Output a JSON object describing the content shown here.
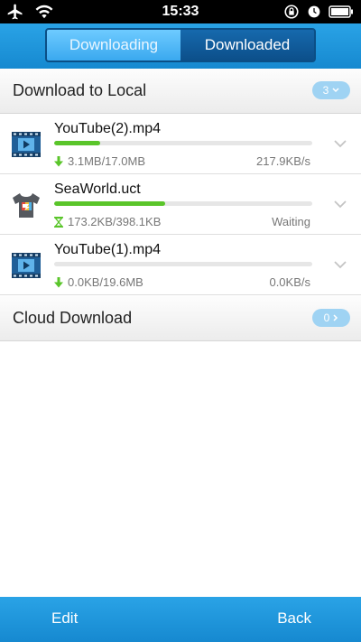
{
  "status_bar": {
    "time": "15:33",
    "left_icons": [
      "airplane-icon",
      "wifi-icon"
    ],
    "right_icons": [
      "rotation-lock-icon",
      "alarm-icon",
      "battery-icon"
    ]
  },
  "header": {
    "tabs": [
      {
        "label": "Downloading",
        "active": true
      },
      {
        "label": "Downloaded",
        "active": false
      }
    ]
  },
  "local_section": {
    "title": "Download to Local",
    "count": "3"
  },
  "downloads": [
    {
      "name": "YouTube(2).mp4",
      "icon": "video-file-icon",
      "status_icon": "download-arrow-icon",
      "progress": 0.18,
      "size": "3.1MB/17.0MB",
      "state": "217.9KB/s"
    },
    {
      "name": "SeaWorld.uct",
      "icon": "theme-shirt-icon",
      "status_icon": "hourglass-icon",
      "progress": 0.43,
      "size": "173.2KB/398.1KB",
      "state": "Waiting"
    },
    {
      "name": "YouTube(1).mp4",
      "icon": "video-file-icon",
      "status_icon": "download-arrow-icon",
      "progress": 0.0,
      "size": "0.0KB/19.6MB",
      "state": "0.0KB/s"
    }
  ],
  "cloud_section": {
    "title": "Cloud Download",
    "count": "0"
  },
  "bottom_bar": {
    "edit_label": "Edit",
    "back_label": "Back"
  },
  "colors": {
    "accent": "#1e95dc",
    "progress": "#5ac52a",
    "badge": "#9fd3f3"
  }
}
